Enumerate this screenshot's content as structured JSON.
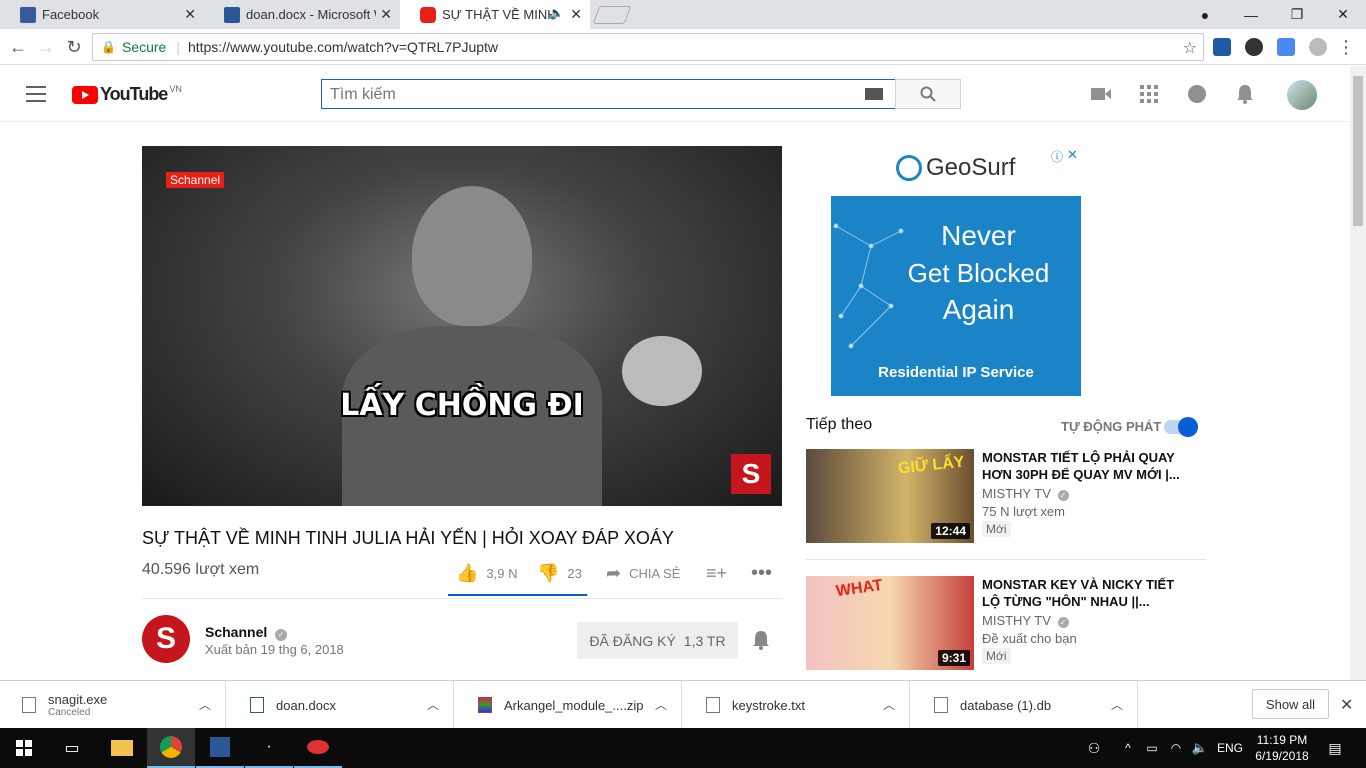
{
  "browser": {
    "tabs": [
      {
        "label": "Facebook"
      },
      {
        "label": "doan.docx - Microsoft W"
      },
      {
        "label": "SỰ THẬT VỀ MINH TI"
      }
    ],
    "secure_label": "Secure",
    "url": "https://www.youtube.com/watch?v=QTRL7PJuptw"
  },
  "youtube": {
    "logo_text": "YouTube",
    "region": "VN",
    "search_placeholder": "Tìm kiếm"
  },
  "video": {
    "caption": "LẤY CHỒNG ĐI",
    "watermark": "Schannel",
    "title": "SỰ THẬT VỀ MINH TINH JULIA HẢI YẾN | HỎI XOAY ĐÁP XOÁY",
    "views": "40.596 lượt xem",
    "likes": "3,9 N",
    "dislikes": "23",
    "share_label": "CHIA SẺ",
    "like_ratio": 0.994
  },
  "owner": {
    "name": "Schannel",
    "published": "Xuất bản 19 thg 6, 2018",
    "subscribe_label": "ĐÃ ĐĂNG KÝ",
    "subscriber_count": "1,3 TR"
  },
  "ad": {
    "brand": "GeoSurf",
    "line1": "Never",
    "line2": "Get Blocked",
    "line3": "Again",
    "footer": "Residential IP Service"
  },
  "up_next": {
    "heading": "Tiếp theo",
    "autoplay_label": "TỰ ĐỘNG PHÁT",
    "items": [
      {
        "title": "MONSTAR TIẾT LỘ PHẢI QUAY HƠN 30PH ĐỂ QUAY MV MỚI |...",
        "channel": "MISTHY TV",
        "meta": "75 N lượt xem",
        "badge": "Mới",
        "duration": "12:44"
      },
      {
        "title": "MONSTAR KEY VÀ NICKY TIẾT LỘ TỪNG \"HÔN\" NHAU ||...",
        "channel": "MISTHY TV",
        "meta": "Đề xuất cho bạn",
        "badge": "Mới",
        "duration": "9:31"
      }
    ]
  },
  "downloads": {
    "items": [
      {
        "name": "snagit.exe",
        "status": "Canceled"
      },
      {
        "name": "doan.docx",
        "status": ""
      },
      {
        "name": "Arkangel_module_....zip",
        "status": ""
      },
      {
        "name": "keystroke.txt",
        "status": ""
      },
      {
        "name": "database (1).db",
        "status": ""
      }
    ],
    "show_all": "Show all"
  },
  "taskbar": {
    "lang": "ENG",
    "time": "11:19 PM",
    "date": "6/19/2018"
  }
}
